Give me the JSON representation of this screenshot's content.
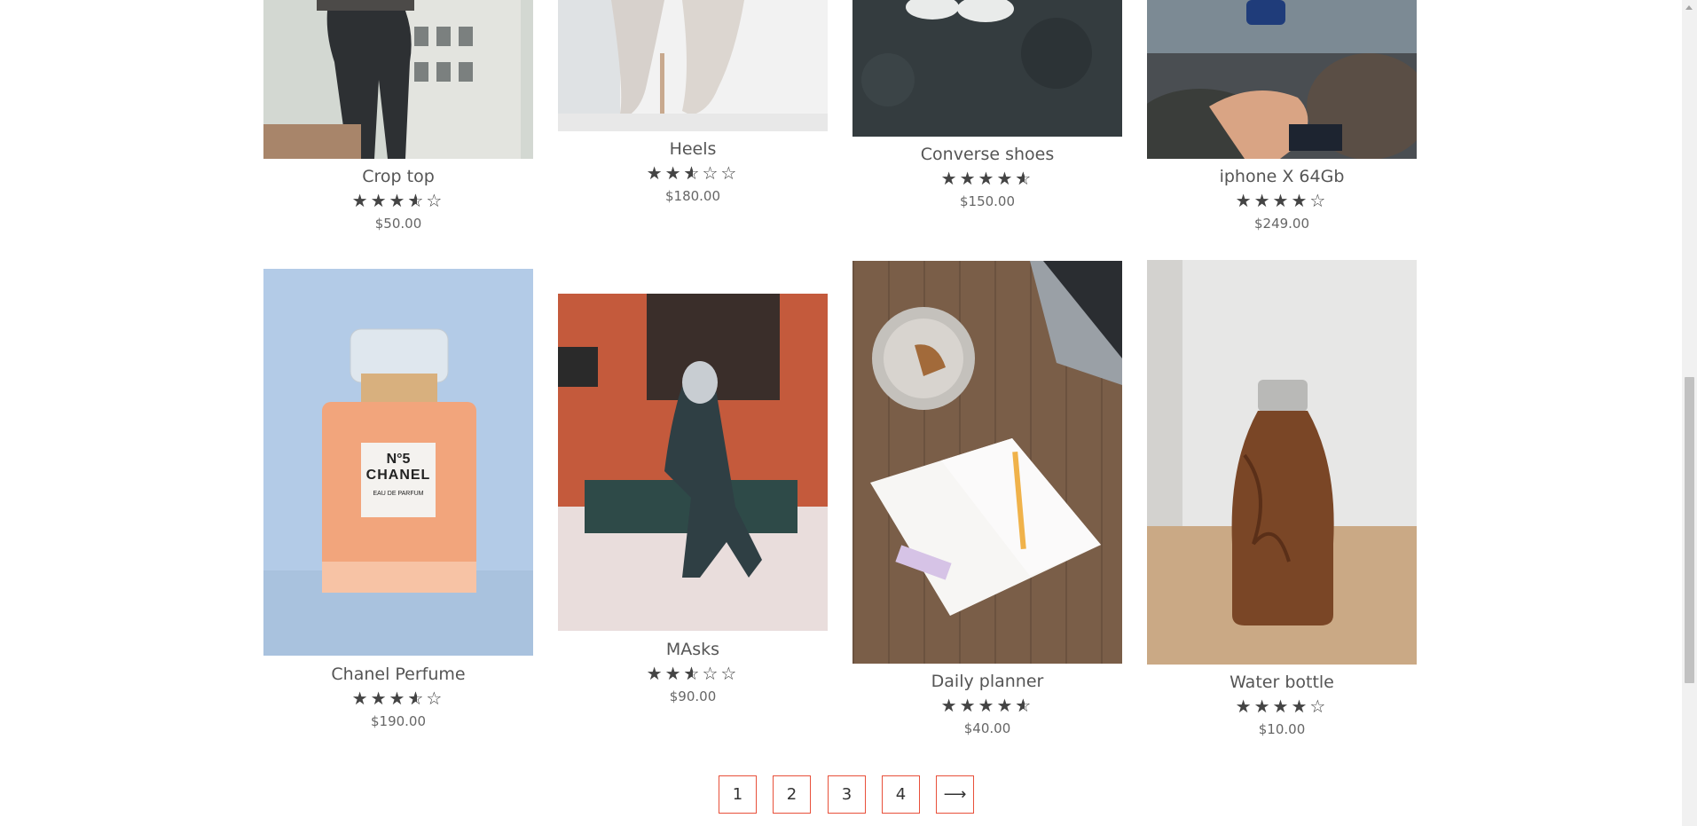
{
  "products": [
    {
      "name": "Crop top",
      "price": "$50.00",
      "rating": 3.5,
      "image": "crop-top-photo"
    },
    {
      "name": "Heels",
      "price": "$180.00",
      "rating": 2.5,
      "image": "heels-photo"
    },
    {
      "name": "Converse shoes",
      "price": "$150.00",
      "rating": 4.5,
      "image": "converse-shoes-photo"
    },
    {
      "name": "iphone X 64Gb",
      "price": "$249.00",
      "rating": 4,
      "image": "iphone-photo"
    },
    {
      "name": "Chanel Perfume",
      "price": "$190.00",
      "rating": 3.5,
      "image": "chanel-perfume-photo"
    },
    {
      "name": "MAsks",
      "price": "$90.00",
      "rating": 2.5,
      "image": "masks-statue-photo"
    },
    {
      "name": "Daily planner",
      "price": "$40.00",
      "rating": 4.5,
      "image": "daily-planner-photo"
    },
    {
      "name": "Water bottle",
      "price": "$10.00",
      "rating": 4,
      "image": "water-bottle-photo"
    }
  ],
  "pagination": {
    "pages": [
      "1",
      "2",
      "3",
      "4"
    ],
    "next_label": "⟶"
  },
  "perfume_label": {
    "line1": "N°5",
    "line2": "CHANEL",
    "line3": "EAU DE PARFUM"
  }
}
